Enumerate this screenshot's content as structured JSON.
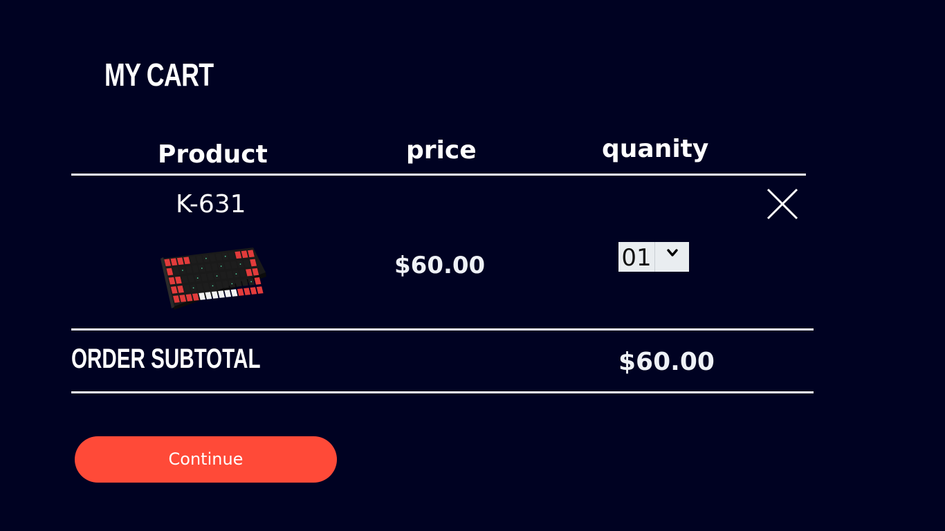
{
  "cart": {
    "title": "MY CART"
  },
  "table": {
    "headers": {
      "product": "Product",
      "price": "price",
      "quantity": "quanity"
    },
    "items": [
      {
        "name": "K-631",
        "price": "$60.00",
        "quantity": "01"
      }
    ]
  },
  "summary": {
    "subtotal_label": "ORDER SUBTOTAL",
    "subtotal_value": "$60.00"
  },
  "actions": {
    "continue_label": "Continue"
  },
  "colors": {
    "background": "#000222",
    "accent": "#ff4a38",
    "text": "#ffffff"
  },
  "icons": {
    "remove": "close-icon",
    "dropdown": "chevron-down-icon"
  }
}
